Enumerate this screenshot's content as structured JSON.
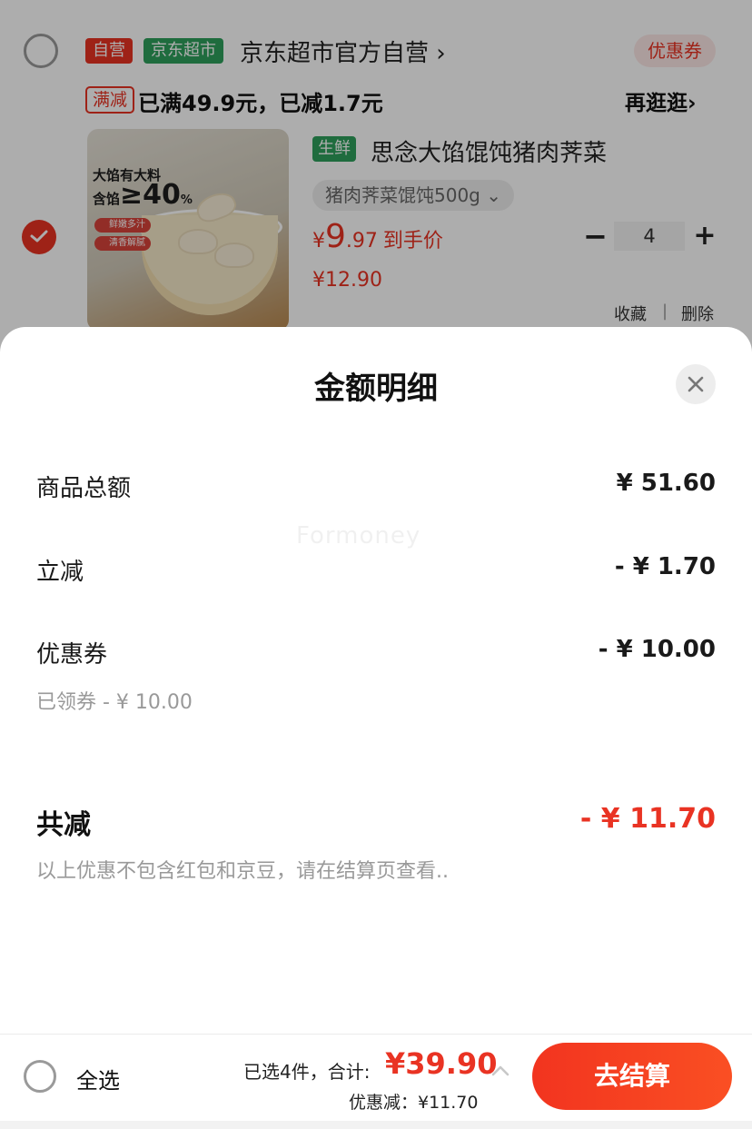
{
  "cart": {
    "shop": {
      "self_tag": "自营",
      "brand_tag": "京东超市",
      "name": "京东超市官方自营 ›",
      "coupon_label": "优惠券"
    },
    "promo": {
      "tag": "满减",
      "text": "已满49.9元，已减1.7元",
      "more_label": "再逛逛›"
    },
    "product": {
      "image_caption_line1": "大馅有大料",
      "image_caption_line2": "含馅",
      "image_caption_big": "≥40",
      "image_caption_pct": "%",
      "image_chip1": "鲜嫩多汁",
      "image_chip2": "清香解腻",
      "fresh_tag": "生鲜",
      "title": "思念大馅馄饨猪肉荠菜",
      "spec": "猪肉荠菜馄饨500g ⌄",
      "price_currency": "¥",
      "price_int": "9",
      "price_dec": ".97",
      "price_suffix": "到手价",
      "original_price": "¥12.90",
      "quantity": "4",
      "qty_minus": "−",
      "qty_plus": "+",
      "favorite_label": "收藏",
      "separator": "|",
      "delete_label": "删除",
      "selected": true
    }
  },
  "sheet": {
    "title": "金额明细",
    "watermark": "Formoney",
    "rows": [
      {
        "label": "商品总额",
        "value": "¥ 51.60"
      },
      {
        "label": "立减",
        "value": "- ¥ 1.70"
      },
      {
        "label": "优惠券",
        "value": "- ¥ 10.00"
      }
    ],
    "coupon_note": "已领券 - ¥ 10.00",
    "total_label": "共减",
    "total_value": "- ¥ 11.70",
    "footnote": "以上优惠不包含红包和京豆，请在结算页查看.."
  },
  "bottom_bar": {
    "select_all_label": "全选",
    "summary_prefix": "已选4件，合计:",
    "total": "¥39.90",
    "discount_line": "优惠减：¥11.70",
    "checkout_label": "去结算"
  },
  "colors": {
    "accent_red": "#e93323",
    "brand_green": "#2fa05c"
  }
}
